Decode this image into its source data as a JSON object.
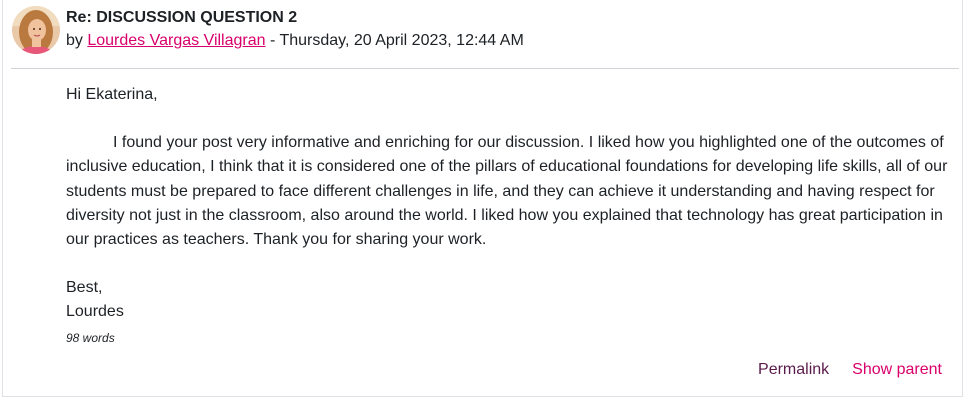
{
  "post": {
    "subject": "Re: DISCUSSION QUESTION 2",
    "by_prefix": "by ",
    "author": "Lourdes Vargas Villagran",
    "date_sep": " - ",
    "date": "Thursday, 20 April 2023, 12:44 AM",
    "avatar_icon": "user-avatar-photo",
    "greeting": "Hi Ekaterina,",
    "paragraph": "I found your post very informative and enriching for our discussion. I liked how you highlighted one of the outcomes of inclusive education, I think that it is considered one of the pillars of educational foundations for developing life skills, all of our students must be prepared to face different challenges in life, and they can achieve it understanding and having respect for diversity not just in the classroom, also around the world. I liked how you explained that technology has great participation in our practices as teachers. Thank you for sharing your work.",
    "signoff": "Best,",
    "signature": "Lourdes",
    "word_count": "98 words"
  },
  "footer": {
    "permalink_label": "Permalink",
    "show_parent_label": "Show parent"
  },
  "colors": {
    "link": "#d9006b",
    "permalink": "#5a1a4a",
    "text": "#1d2125"
  }
}
